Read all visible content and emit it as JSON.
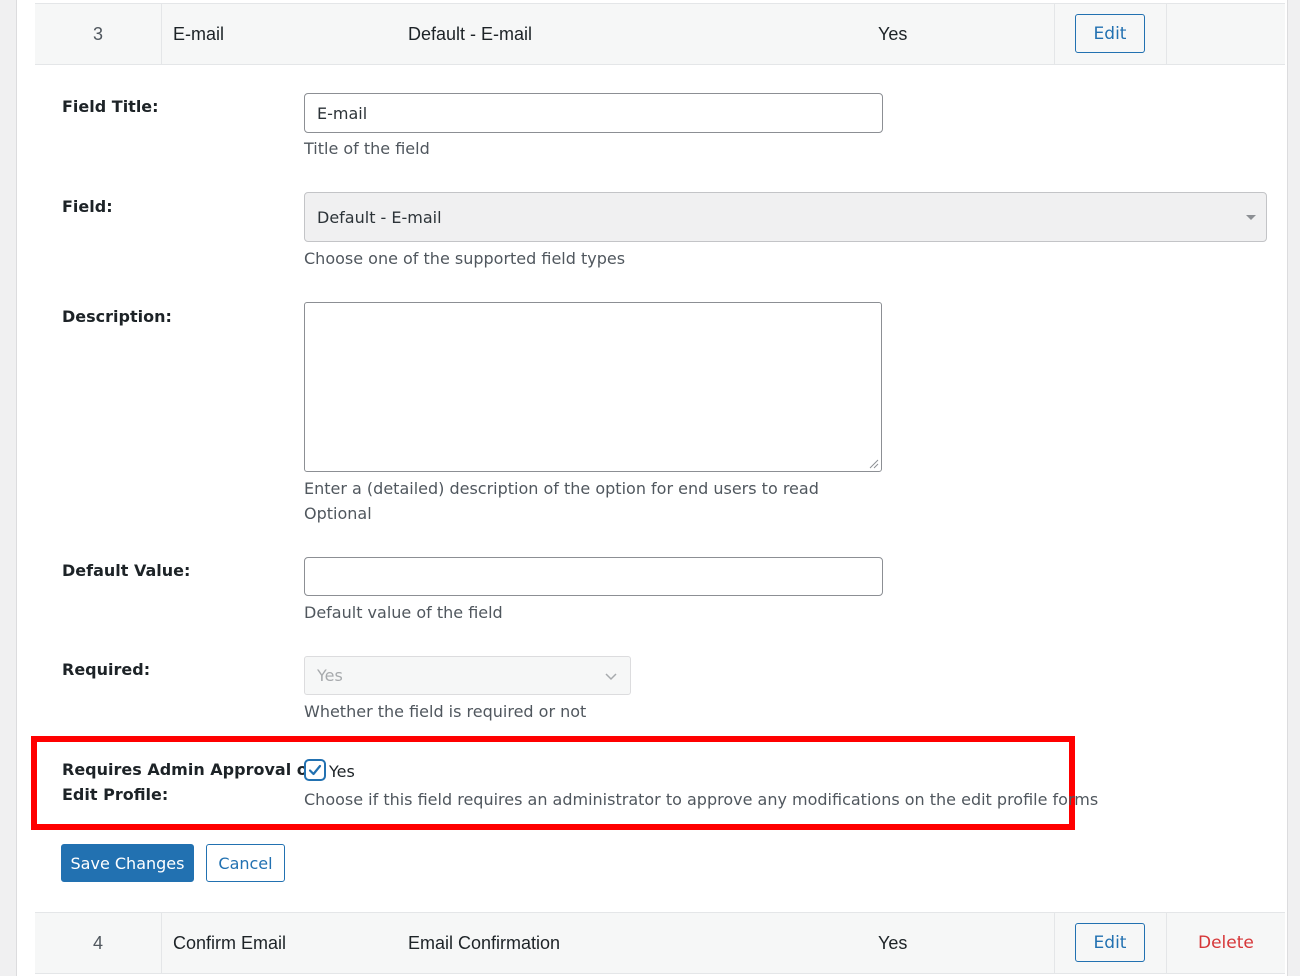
{
  "rows": [
    {
      "num": "3",
      "title": "E-mail",
      "type": "Default - E-mail",
      "required": "Yes",
      "edit_label": "Edit",
      "delete_label": ""
    },
    {
      "num": "4",
      "title": "Confirm Email",
      "type": "Email Confirmation",
      "required": "Yes",
      "edit_label": "Edit",
      "delete_label": "Delete"
    }
  ],
  "form": {
    "field_title": {
      "label": "Field Title:",
      "value": "E-mail",
      "hint": "Title of the field"
    },
    "field": {
      "label": "Field:",
      "value": "Default - E-mail",
      "hint": "Choose one of the supported field types"
    },
    "description": {
      "label": "Description:",
      "value": "",
      "hint": "Enter a (detailed) description of the option for end users to read",
      "hint2": "Optional"
    },
    "default_value": {
      "label": "Default Value:",
      "value": "",
      "hint": "Default value of the field"
    },
    "required": {
      "label": "Required:",
      "value": "Yes",
      "hint": "Whether the field is required or not"
    },
    "admin_approval": {
      "label_line1": "Requires Admin Approval on",
      "label_line2": "Edit Profile:",
      "checkbox_label": "Yes",
      "checked": true,
      "hint": "Choose if this field requires an administrator to approve any modifications on the edit profile forms"
    },
    "save_label": "Save Changes",
    "cancel_label": "Cancel"
  },
  "colors": {
    "accent": "#2271b1",
    "highlight": "#ff0000",
    "danger": "#d63638"
  },
  "icons": {
    "select_caret": "caret-down-icon",
    "required_chevron": "chevron-down-icon",
    "checkbox": "check-icon"
  }
}
